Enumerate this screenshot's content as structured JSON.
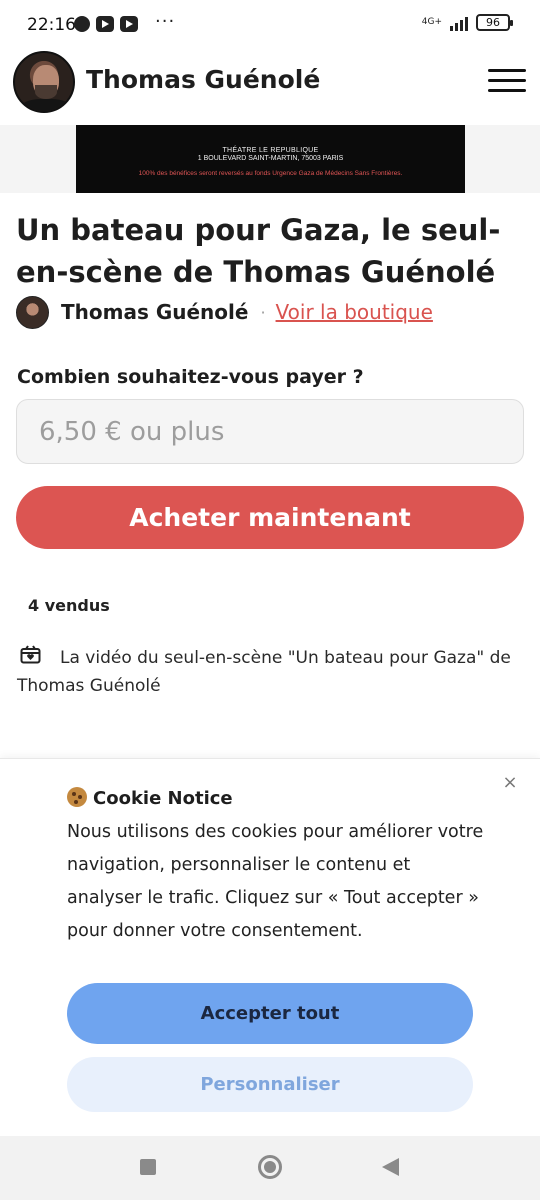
{
  "status_bar": {
    "time": "22:16",
    "dots": "···",
    "network": "4G+",
    "battery": "96"
  },
  "header": {
    "site_title": "Thomas Guénolé"
  },
  "banner": {
    "line1": "THÉATRE LE REPUBLIQUE",
    "line2": "1 BOULEVARD SAINT-MARTIN, 75003 PARIS",
    "line3": "100% des bénéfices seront reversés au fonds Urgence Gaza de Médecins Sans Frontières."
  },
  "product": {
    "title": "Un bateau pour Gaza, le seul-en-scène de Thomas Guénolé",
    "author_name": "Thomas Guénolé",
    "separator": "·",
    "shop_link": "Voir la boutique",
    "price_label": "Combien souhaitez-vous payer ?",
    "price_placeholder": "6,50 € ou plus",
    "buy_label": "Acheter maintenant",
    "sold_count": "4 vendus",
    "description": "La vidéo du seul-en-scène \"Un bateau pour Gaza\" de Thomas Guénolé"
  },
  "cookie": {
    "title": "Cookie Notice",
    "text": "Nous utilisons des cookies pour améliorer votre navigation, personnaliser le contenu et analyser le trafic. Cliquez sur « Tout accepter » pour donner votre consentement.",
    "close": "×",
    "accept_label": "Accepter tout",
    "customize_label": "Personnaliser"
  },
  "colors": {
    "accent": "#dc5552",
    "accept_button": "#6fa4ef",
    "customize_button": "#e8f0fc"
  },
  "icons": [
    "chat-bubble-icon",
    "youtube-icon",
    "signal-icon",
    "battery-icon",
    "menu-icon",
    "gift-box-icon",
    "cookie-icon",
    "close-icon",
    "recents-icon",
    "home-icon",
    "back-icon"
  ]
}
